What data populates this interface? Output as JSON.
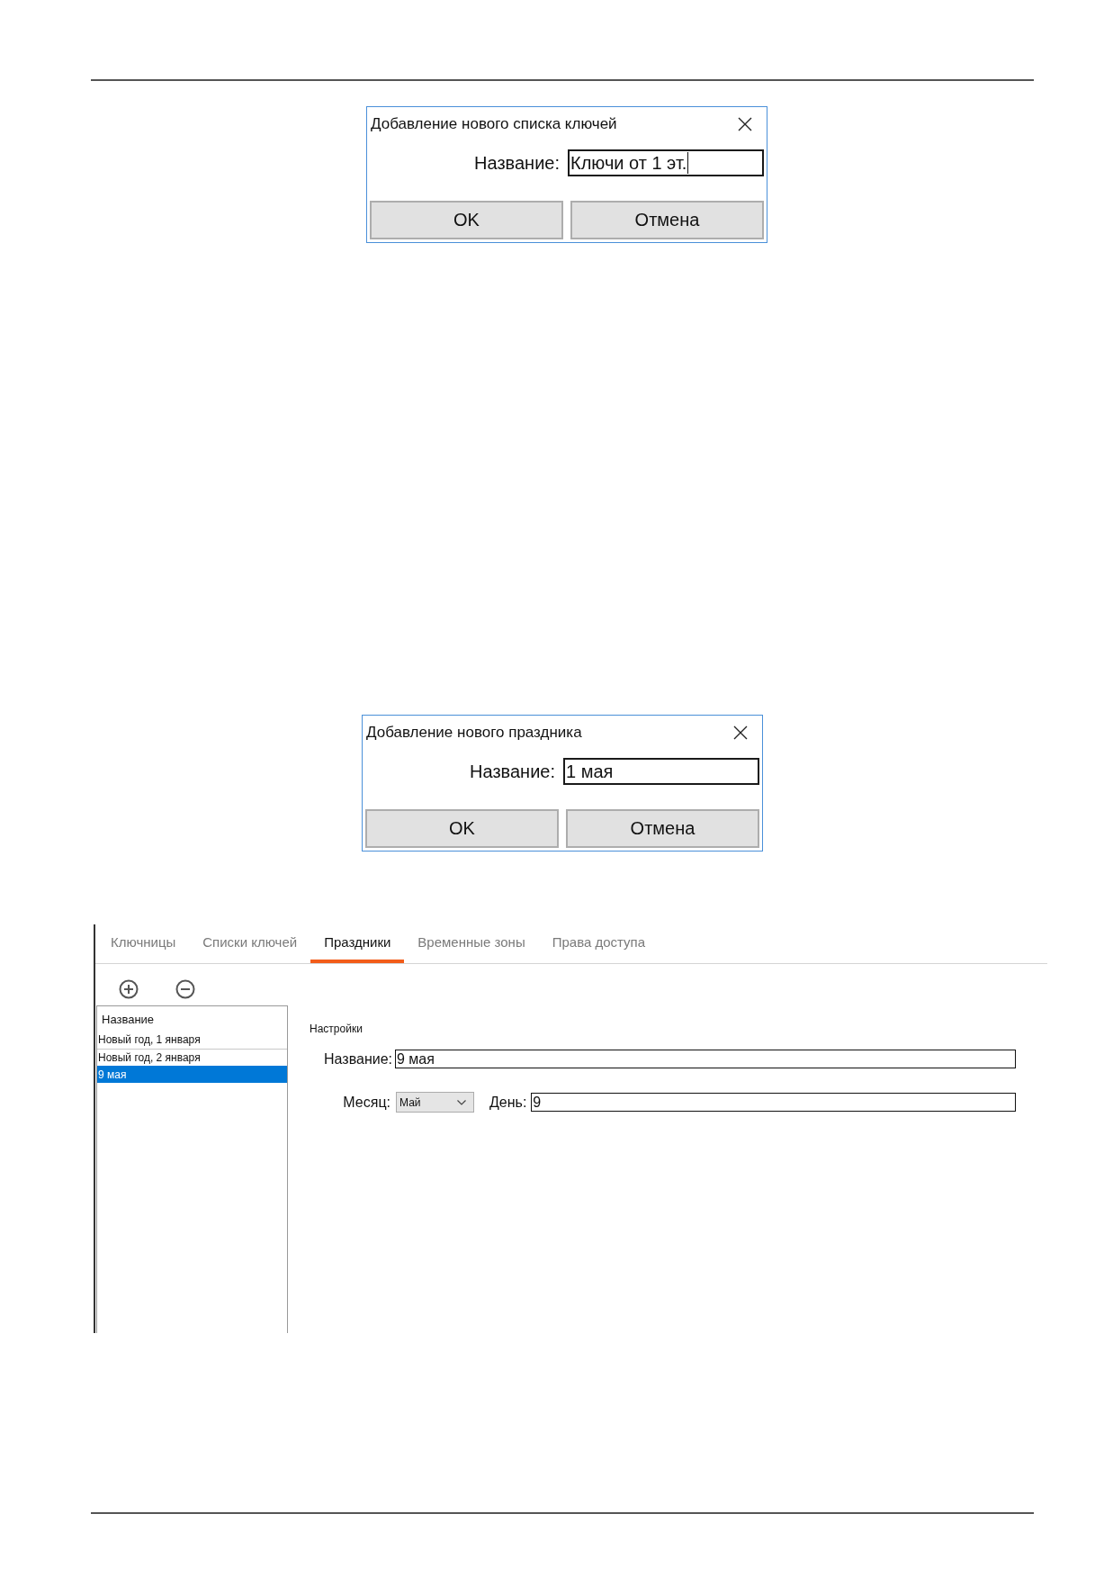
{
  "dialogs": [
    {
      "title": "Добавление нового списка ключей",
      "field": {
        "label": "Название:",
        "value": "Ключи от 1 эт.",
        "focused": true
      },
      "buttons": [
        "OK",
        "Отмена"
      ]
    },
    {
      "title": "Добавление нового праздника",
      "field": {
        "label": "Название:",
        "value": "1 мая",
        "focused": false
      },
      "buttons": [
        "OK",
        "Отмена"
      ]
    }
  ],
  "panel": {
    "tabs": [
      {
        "label": "Ключницы",
        "selected": false
      },
      {
        "label": "Списки ключей",
        "selected": false
      },
      {
        "label": "Праздники",
        "selected": true
      },
      {
        "label": "Временные зоны",
        "selected": false
      },
      {
        "label": "Права доступа",
        "selected": false
      }
    ],
    "list": {
      "header": "Название",
      "rows": [
        {
          "label": "Новый год, 1 января",
          "selected": false
        },
        {
          "label": "Новый год, 2 января",
          "selected": false
        },
        {
          "label": "9 мая",
          "selected": true
        }
      ]
    },
    "settings": {
      "title": "Настройки",
      "name": {
        "label": "Название:",
        "value": "9 мая"
      },
      "month": {
        "label": "Месяц:",
        "value": "Май"
      },
      "day": {
        "label": "День:",
        "value": "9"
      }
    }
  }
}
